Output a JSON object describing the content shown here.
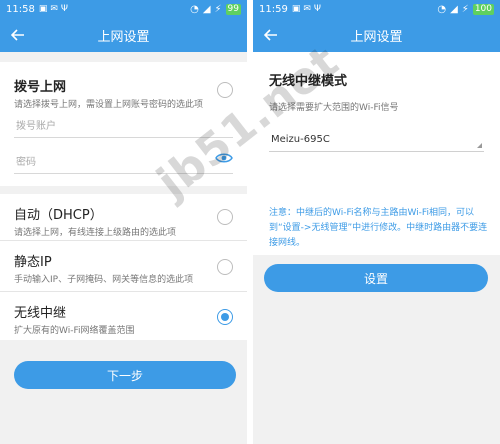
{
  "left": {
    "status": {
      "time": "11:58",
      "battery": "99"
    },
    "appbar": {
      "title": "上网设置"
    },
    "pppoe": {
      "title": "拨号上网",
      "subtitle": "请选择拨号上网，需设置上网账号密码的选此项",
      "account_placeholder": "拨号账户",
      "password_placeholder": "密码",
      "selected": false
    },
    "dhcp": {
      "title": "自动（DHCP）",
      "subtitle": "请选择上网，有线连接上级路由的选此项",
      "selected": false
    },
    "static": {
      "title": "静态IP",
      "subtitle": "手动输入IP、子网掩码、网关等信息的选此项",
      "selected": false
    },
    "repeater": {
      "title": "无线中继",
      "subtitle": "扩大原有的Wi-Fi网络覆盖范围",
      "selected": true
    },
    "next_label": "下一步"
  },
  "right": {
    "status": {
      "time": "11:59",
      "battery": "100"
    },
    "appbar": {
      "title": "上网设置"
    },
    "mode_title": "无线中继模式",
    "mode_subtitle": "请选择需要扩大范围的Wi-Fi信号",
    "selected_ssid": "Meizu-695C",
    "note": "注意：中继后的Wi-Fi名称与主路由Wi-Fi相同，可以到“设置->无线管理”中进行修改。中继时路由器不要连接网线。",
    "settings_label": "设置"
  },
  "watermark": "jb51.net",
  "colors": {
    "accent": "#3d9be6",
    "background": "#f1f1f1",
    "card": "#ffffff"
  }
}
